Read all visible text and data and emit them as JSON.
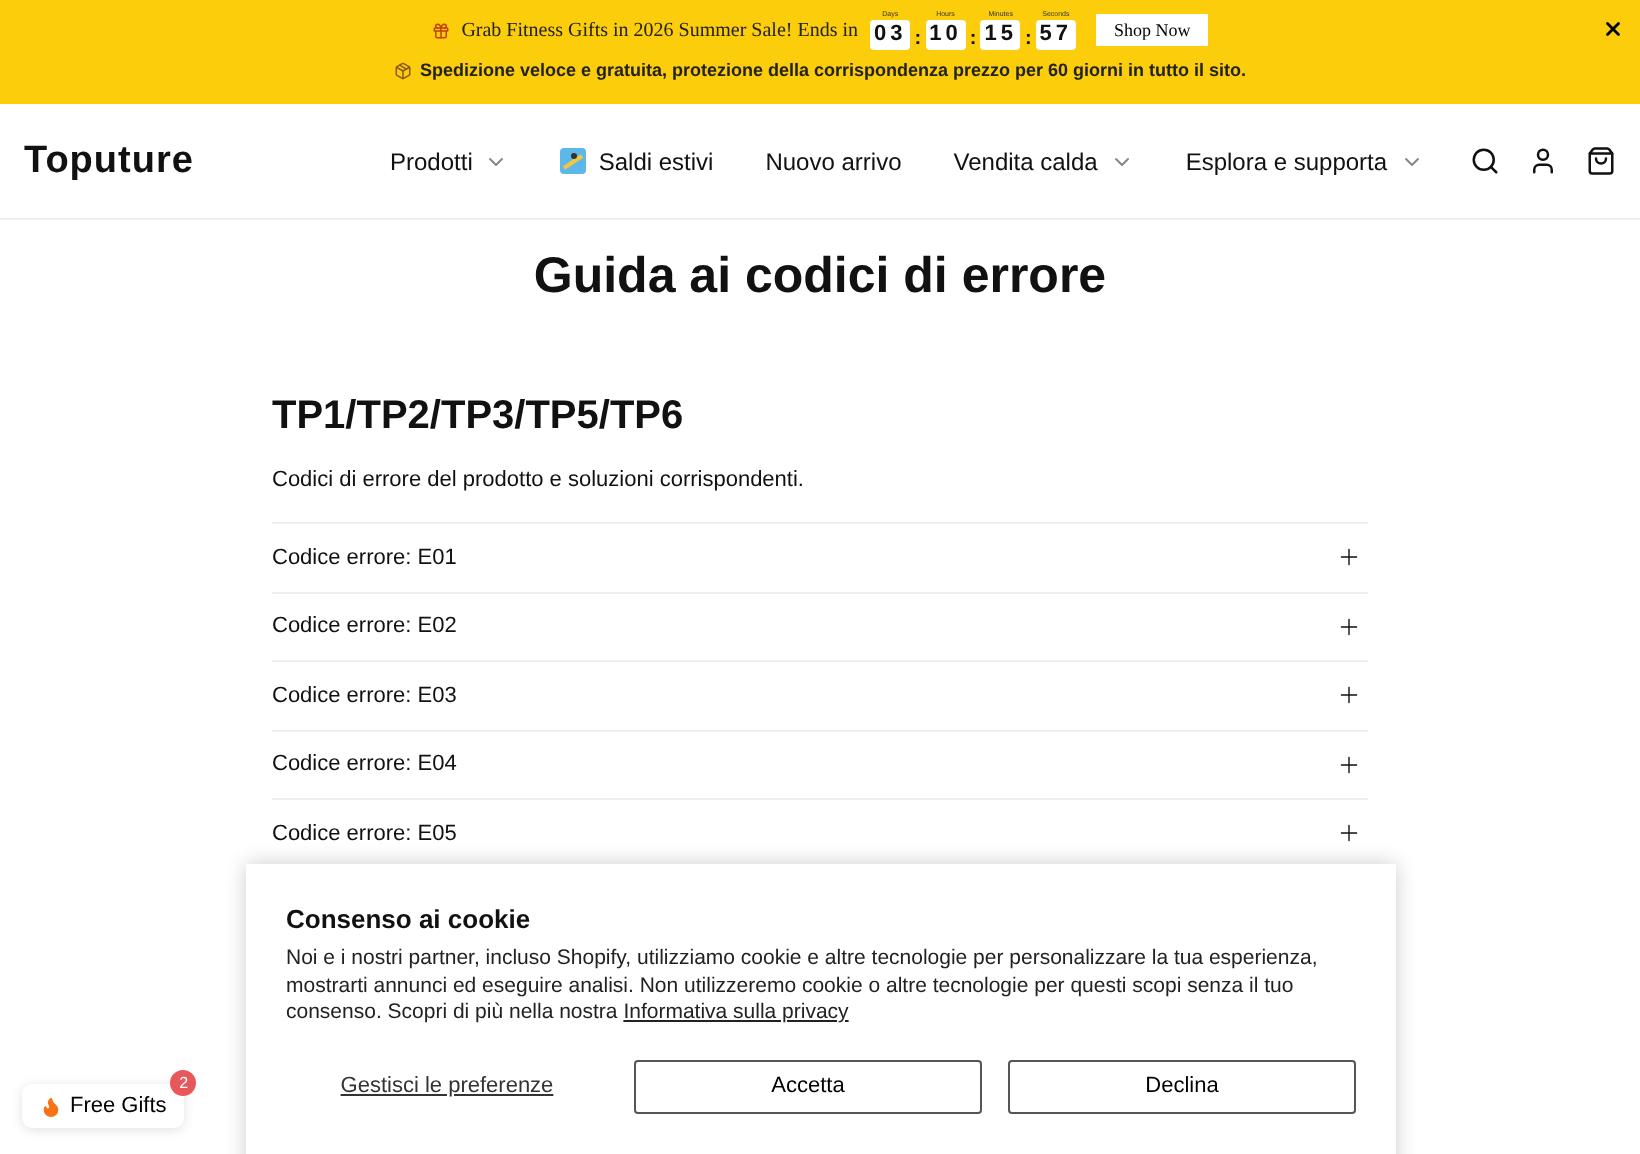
{
  "promo_bar": {
    "message": "Grab Fitness Gifts in 2026 Summer Sale! Ends in",
    "countdown": [
      {
        "label": "Days",
        "value": "03"
      },
      {
        "label": "Hours",
        "value": "10"
      },
      {
        "label": "Minutes",
        "value": "15"
      },
      {
        "label": "Seconds",
        "value": "57"
      }
    ],
    "separator": ":",
    "button": "Shop Now",
    "shipping_note": "Spedizione veloce e gratuita, protezione della corrispondenza prezzo per 60 giorni in tutto il sito."
  },
  "header": {
    "logo": "Toputure",
    "nav": [
      {
        "label": "Prodotti",
        "dropdown": true,
        "icon": false
      },
      {
        "label": "Saldi estivi",
        "dropdown": false,
        "icon": true
      },
      {
        "label": "Nuovo arrivo",
        "dropdown": false,
        "icon": false
      },
      {
        "label": "Vendita calda",
        "dropdown": true,
        "icon": false
      },
      {
        "label": "Esplora e supporta",
        "dropdown": true,
        "icon": false
      }
    ]
  },
  "page": {
    "title": "Guida ai codici di errore",
    "section_title": "TP1/TP2/TP3/TP5/TP6",
    "description": "Codici di errore del prodotto e soluzioni corrispondenti.",
    "accordion": [
      {
        "label": "Codice errore: E01",
        "expanded": false
      },
      {
        "label": "Codice errore: E02",
        "expanded": false
      },
      {
        "label": "Codice errore: E03",
        "expanded": false
      },
      {
        "label": "Codice errore: E04",
        "expanded": false
      },
      {
        "label": "Codice errore: E05",
        "expanded": false
      }
    ]
  },
  "cookie_banner": {
    "title": "Consenso ai cookie",
    "text": "Noi e i nostri partner, incluso Shopify, utilizziamo cookie e altre tecnologie per personalizzare la tua esperienza, mostrarti annunci ed eseguire analisi. Non utilizzeremo cookie o altre tecnologie per questi scopi senza il tuo consenso. Scopri di più nella nostra",
    "link": "Informativa sulla privacy",
    "manage": "Gestisci le preferenze",
    "accept": "Accetta",
    "decline": "Declina"
  },
  "gifts_button": {
    "label": "Free Gifts",
    "badge": "2"
  }
}
